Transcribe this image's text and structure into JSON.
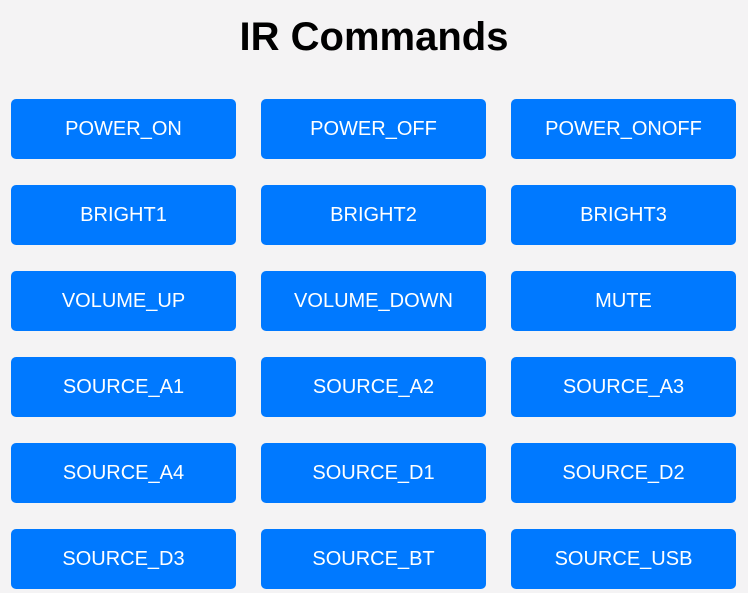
{
  "title": "IR Commands",
  "accent_color": "#0079ff",
  "buttons": [
    "POWER_ON",
    "POWER_OFF",
    "POWER_ONOFF",
    "BRIGHT1",
    "BRIGHT2",
    "BRIGHT3",
    "VOLUME_UP",
    "VOLUME_DOWN",
    "MUTE",
    "SOURCE_A1",
    "SOURCE_A2",
    "SOURCE_A3",
    "SOURCE_A4",
    "SOURCE_D1",
    "SOURCE_D2",
    "SOURCE_D3",
    "SOURCE_BT",
    "SOURCE_USB"
  ]
}
